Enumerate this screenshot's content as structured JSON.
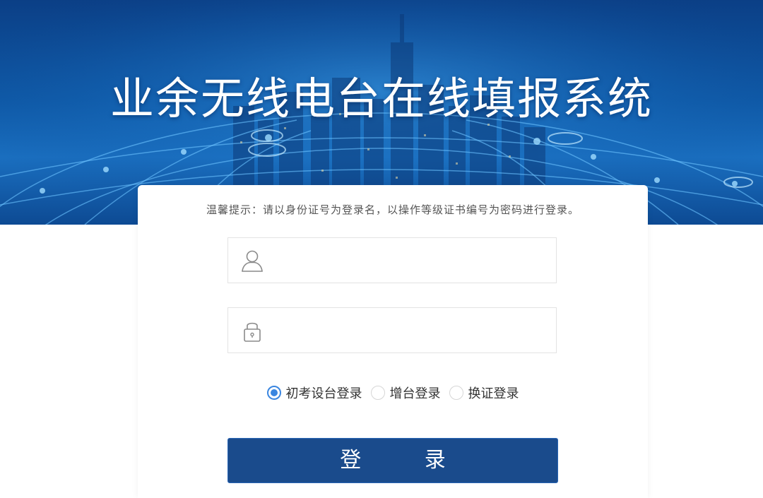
{
  "header": {
    "title": "业余无线电台在线填报系统"
  },
  "login": {
    "hint": "温馨提示：请以身份证号为登录名，以操作等级证书编号为密码进行登录。",
    "username": {
      "value": "",
      "placeholder": "",
      "icon": "user-icon"
    },
    "password": {
      "value": "",
      "placeholder": "",
      "icon": "lock-icon"
    },
    "login_types": [
      {
        "label": "初考设台登录",
        "checked": true
      },
      {
        "label": "增台登录",
        "checked": false
      },
      {
        "label": "换证登录",
        "checked": false
      }
    ],
    "submit_label": "登 录"
  },
  "colors": {
    "banner": "#0f5aa8",
    "button": "#1a4b8c",
    "radio_accent": "#3a86e0"
  }
}
